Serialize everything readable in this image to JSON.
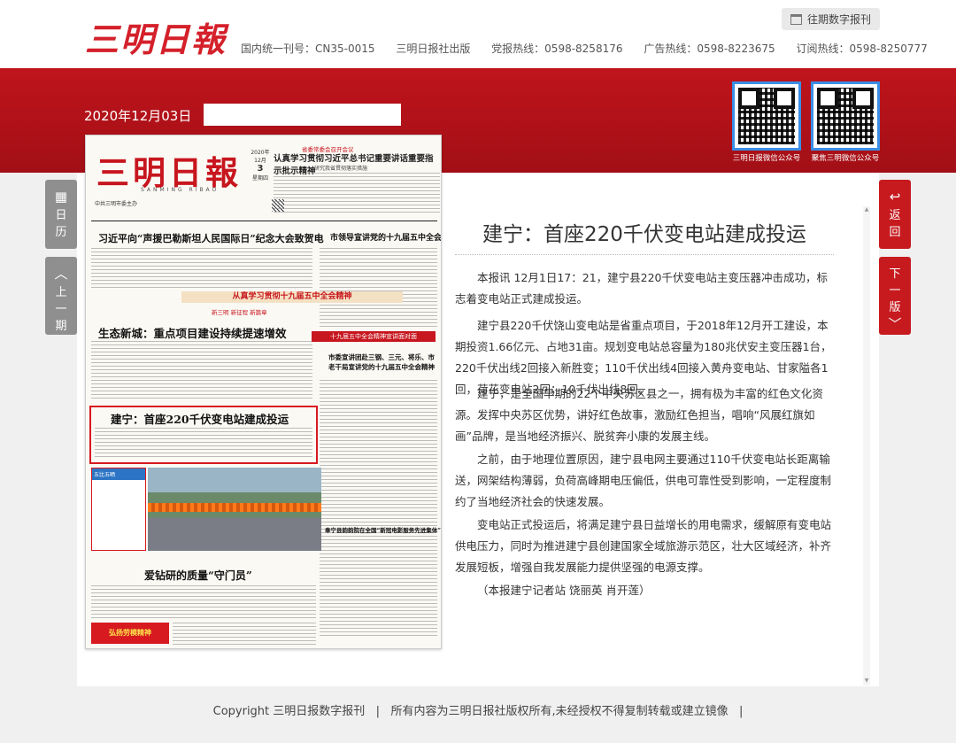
{
  "header": {
    "logo": "三明日報",
    "archive_button": "往期数字报刊",
    "info": [
      "国内统一刊号：CN35-0015",
      "三明日报社出版",
      "党报热线：0598-8258176",
      "广告热线：0598-8223675",
      "订阅热线：0598-8250777"
    ]
  },
  "date": "2020年12月03日",
  "qr_codes": [
    {
      "label": "三明日报微信公众号"
    },
    {
      "label": "聚焦三明微信公众号"
    }
  ],
  "nav": {
    "calendar": [
      "日",
      "历"
    ],
    "prev": [
      "上",
      "一",
      "期"
    ],
    "back": [
      "返",
      "回"
    ],
    "next": [
      "下",
      "一",
      "版"
    ]
  },
  "paper": {
    "logo": "三明日報",
    "pinyin": "SANMING RIBAO",
    "sub": "中共三明市委主办",
    "date_year": "2020年12月",
    "date_day": "3",
    "date_week": "星期四",
    "top_tag": "省委常委会召开会议",
    "top_headline": "认真学习贯彻习近平总书记重要讲话重要指示批示精神",
    "top_sub": "研究我省贯彻落实措施",
    "headline1": "习近平向“声援巴勒斯坦人民国际日”纪念大会致贺电",
    "headline2": "市领导宣讲党的十九届五中全会精神",
    "banner": "从真学习贯彻十九届五中全会精神",
    "byline": "新三明 新征程 新篇章",
    "headline3": "生态新城：重点项目建设持续提速增效",
    "badge": "十九届五中全会精神宣讲面对面",
    "headline4": "市委宣讲团赴三钢、三元、将乐、市老干局宣讲党的十九届五中全会精神",
    "headline5": "建宁：首座220千伏变电站建成投运",
    "headline6": "爱钻研的质量“守门员”",
    "headline7": "奉宁县韵韵院在全国“新冠电影服务先进集体”称号",
    "photo_tag": "弘扬劳模精神",
    "photo_sub": "争当时代先锋",
    "left_badge": "五比五晒",
    "bottom_badge": "弘扬劳模精神 争当时代先锋"
  },
  "article": {
    "title": "建宁：首座220千伏变电站建成投运",
    "paragraphs": [
      "本报讯 12月1日17：21，建宁县220千伏变电站主变压器冲击成功，标志着变电站正式建成投运。",
      "建宁县220千伏饶山变电站是省重点项目，于2018年12月开工建设，本期投资1.66亿元、占地31亩。规划变电站总容量为180兆伏安主变压器1台，220千伏出线2回接入新胜变；110千伏出线4回接入黄舟变电站、甘家隘各1回，荷花变电站2回；10千伏出线8回。",
      "建宁，是全国早期的22个中央苏区县之一，拥有极为丰富的红色文化资源。发挥中央苏区优势，讲好红色故事，激励红色担当，唱响“风展红旗如画”品牌，是当地经济振兴、脱贫奔小康的发展主线。",
      "之前，由于地理位置原因，建宁县电网主要通过110千伏变电站长距离输送，网架结构薄弱，负荷高峰期电压偏低，供电可靠性受到影响，一定程度制约了当地经济社会的快速发展。",
      "变电站正式投运后，将满足建宁县日益增长的用电需求，缓解原有变电站供电压力，同时为推进建宁县创建国家全域旅游示范区，壮大区域经济，补齐发展短板，增强自我发展能力提供坚强的电源支撑。",
      "（本报建宁记者站 饶丽英 肖开莲）"
    ]
  },
  "footer": {
    "text": "Copyright 三明日报数字报刊   |   所有内容为三明日报社版权所有,未经授权不得复制转载或建立镜像   |"
  },
  "colors": {
    "brand_red": "#c0141c",
    "tab_gray": "#8f8f8f",
    "highlight_red": "#d71920"
  }
}
